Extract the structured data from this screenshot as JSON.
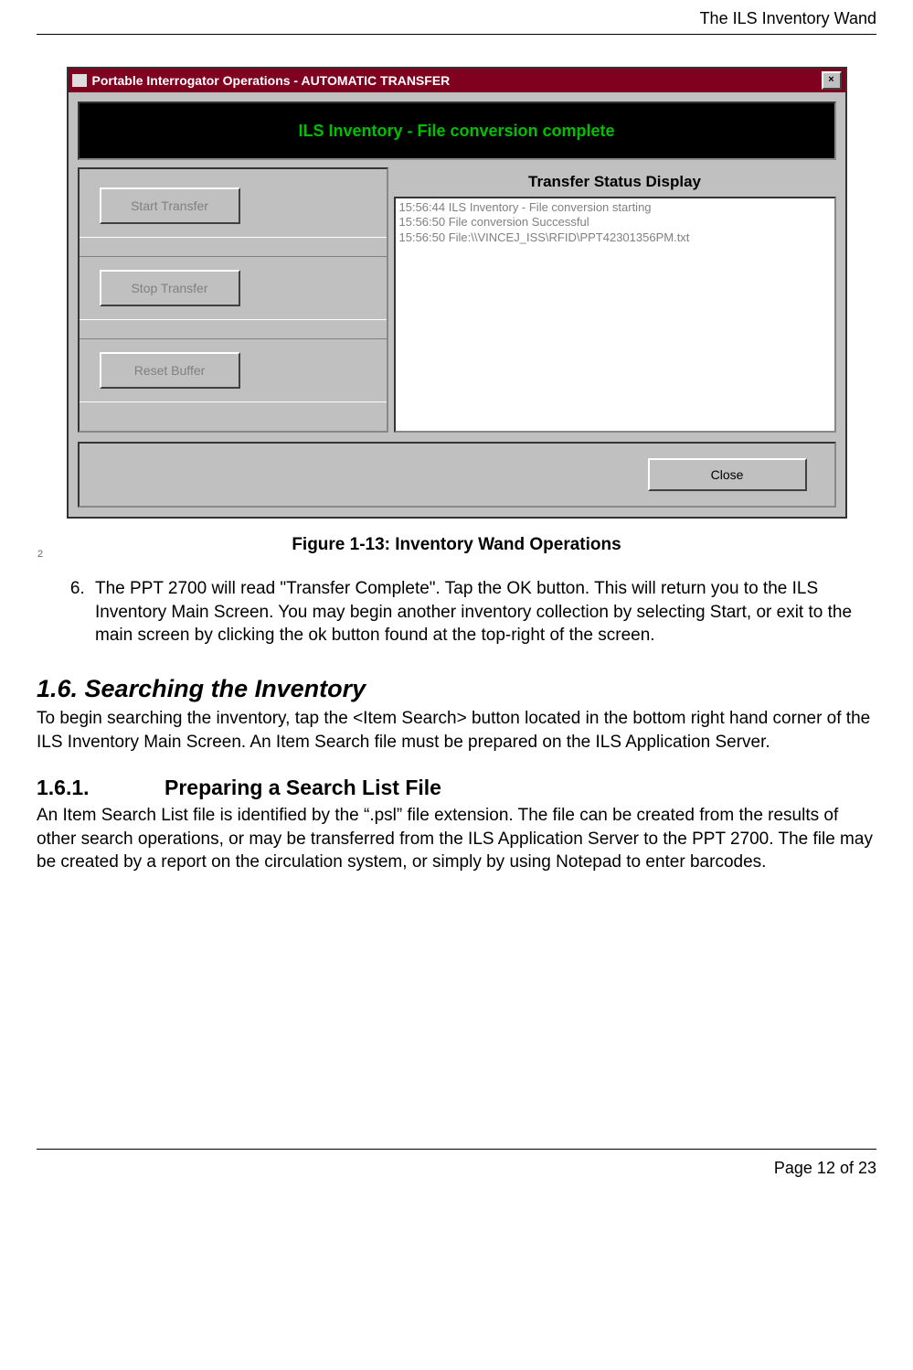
{
  "header": {
    "running_title": "The ILS Inventory Wand"
  },
  "window": {
    "title": "Portable Interrogator Operations  -  AUTOMATIC TRANSFER",
    "close_glyph": "×",
    "banner": "ILS Inventory - File conversion complete",
    "left_edge_digit": "2",
    "buttons": {
      "start": "Start Transfer",
      "stop": "Stop Transfer",
      "reset": "Reset Buffer",
      "close": "Close"
    },
    "status_label": "Transfer Status Display",
    "status_lines": [
      "15:56:44 ILS Inventory - File conversion starting",
      "15:56:50 File conversion Successful",
      "15:56:50 File:\\\\VINCEJ_ISS\\RFID\\PPT42301356PM.txt"
    ]
  },
  "figure_caption": "Figure 1-13: Inventory Wand Operations",
  "list_start": 6,
  "list_item_6": "The PPT 2700 will read \"Transfer Complete\".  Tap the OK button.  This will return you to the ILS Inventory Main Screen. You may begin another inventory collection by selecting Start, or exit to the main screen by clicking the ok button found at the top-right of the screen.",
  "section_1_6": {
    "heading": "1.6.  Searching the Inventory",
    "body": "To begin searching the inventory, tap the <Item Search> button located in the bottom right hand corner of the ILS Inventory Main Screen. An Item Search file must be prepared on the ILS Application Server."
  },
  "section_1_6_1": {
    "num": "1.6.1.",
    "title": "Preparing a Search List File",
    "body": "An Item Search List file is identified by the “.psl” file extension. The file can be created from the results of other search operations, or may be transferred from the ILS Application Server to the PPT 2700. The file may be created by a report on the circulation system, or simply by using Notepad to enter barcodes."
  },
  "footer": {
    "page": "Page 12 of 23"
  }
}
